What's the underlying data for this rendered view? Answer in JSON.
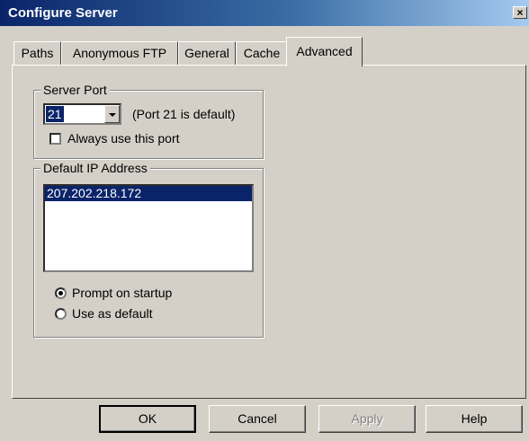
{
  "window": {
    "title": "Configure Server",
    "close_label": "×"
  },
  "tabs": [
    {
      "label": "Paths"
    },
    {
      "label": "Anonymous FTP"
    },
    {
      "label": "General"
    },
    {
      "label": "Cache"
    },
    {
      "label": "Advanced",
      "active": true
    }
  ],
  "server_port": {
    "group_label": "Server Port",
    "port_value": "21",
    "hint": "(Port 21 is default)",
    "always_use_label": "Always use this port",
    "always_use_checked": false
  },
  "default_ip": {
    "group_label": "Default IP Address",
    "addresses": [
      "207.202.218.172"
    ],
    "selected": "207.202.218.172",
    "radio_prompt_label": "Prompt on startup",
    "radio_default_label": "Use as default",
    "selected_radio": "Prompt on startup"
  },
  "buttons": {
    "ok": "OK",
    "cancel": "Cancel",
    "apply": "Apply",
    "apply_enabled": false,
    "help": "Help"
  }
}
